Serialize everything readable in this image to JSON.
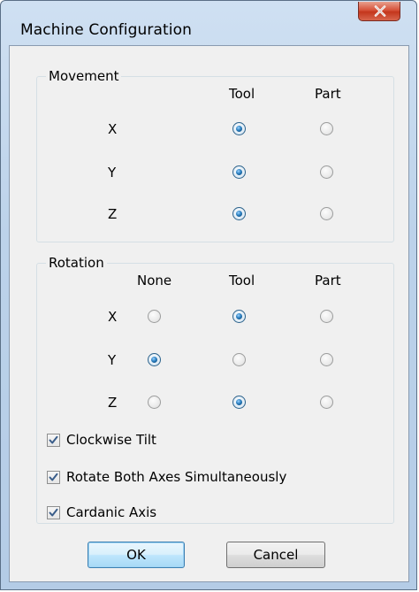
{
  "window": {
    "title": "Machine Configuration"
  },
  "movement": {
    "label": "Movement",
    "columns": [
      "Tool",
      "Part"
    ],
    "rows": [
      {
        "axis": "X",
        "selected": "Tool"
      },
      {
        "axis": "Y",
        "selected": "Tool"
      },
      {
        "axis": "Z",
        "selected": "Tool"
      }
    ]
  },
  "rotation": {
    "label": "Rotation",
    "columns": [
      "None",
      "Tool",
      "Part"
    ],
    "rows": [
      {
        "axis": "X",
        "selected": "Tool"
      },
      {
        "axis": "Y",
        "selected": "None"
      },
      {
        "axis": "Z",
        "selected": "Tool"
      }
    ]
  },
  "options": {
    "clockwise_tilt": {
      "label": "Clockwise Tilt",
      "checked": true
    },
    "rotate_both": {
      "label": "Rotate Both Axes Simultaneously",
      "checked": true
    },
    "cardanic_axis": {
      "label": "Cardanic Axis",
      "checked": true
    }
  },
  "buttons": {
    "ok": "OK",
    "cancel": "Cancel"
  },
  "icons": {
    "close": "close-icon",
    "check": "checkmark-icon"
  },
  "colors": {
    "title_bar": "#bcd2ea",
    "close_button": "#d6523a",
    "client_bg": "#f0f0f0",
    "radio_selected": "#2a7fc0",
    "default_button_border": "#3c7fb1"
  }
}
